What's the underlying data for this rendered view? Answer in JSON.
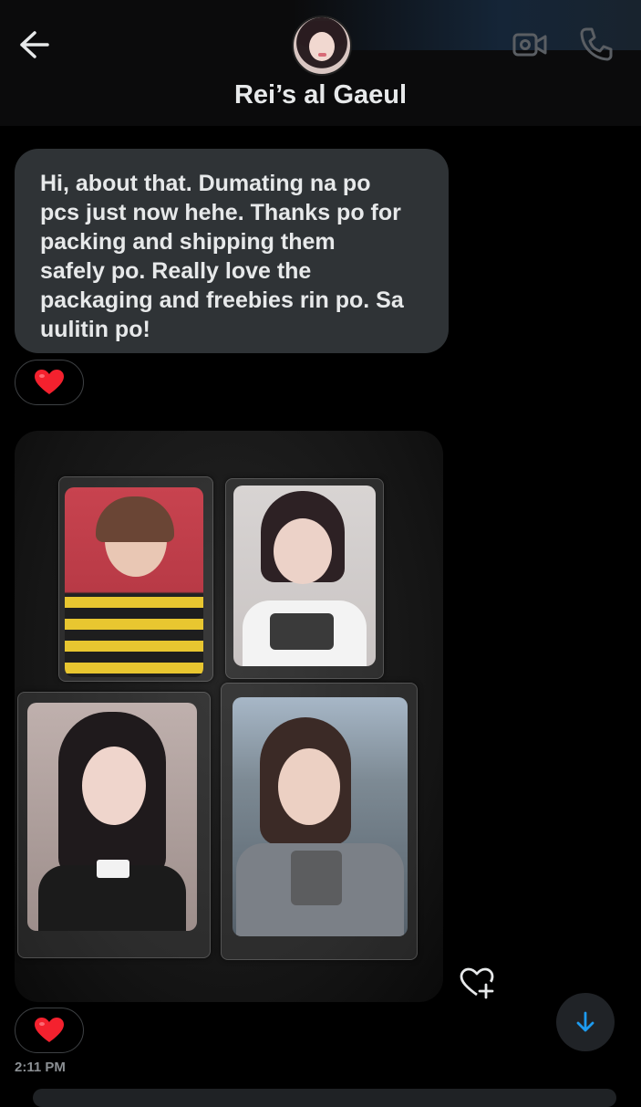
{
  "header": {
    "title": "Rei’s al Gaeul",
    "back_icon": "arrow-left-icon",
    "video_icon": "video-camera-icon",
    "call_icon": "phone-icon"
  },
  "messages": [
    {
      "type": "text",
      "text": "Hi, about that. Dumating na po pcs just now hehe. Thanks po for packing and shipping them safely po. Really love the packaging and freebies rin po. Sa uulitin po!",
      "lines": [
        "Hi, about that. Dumating na po",
        "pcs just now hehe. Thanks po for",
        "packing and shipping them",
        "safely po. Really love the",
        "packaging and freebies rin po. Sa",
        "uulitin po!"
      ],
      "reaction": "❤️"
    },
    {
      "type": "photo",
      "reaction": "❤️",
      "timestamp": "2:11 PM"
    }
  ],
  "colors": {
    "background": "#000000",
    "bubble": "#2f3336",
    "text": "#e7e9ea",
    "muted": "#8b8f93",
    "accent": "#1d9bf0",
    "heart": "#f91880"
  },
  "icons": {
    "react_add": "heart-plus-icon",
    "scroll_down": "arrow-down-icon"
  }
}
